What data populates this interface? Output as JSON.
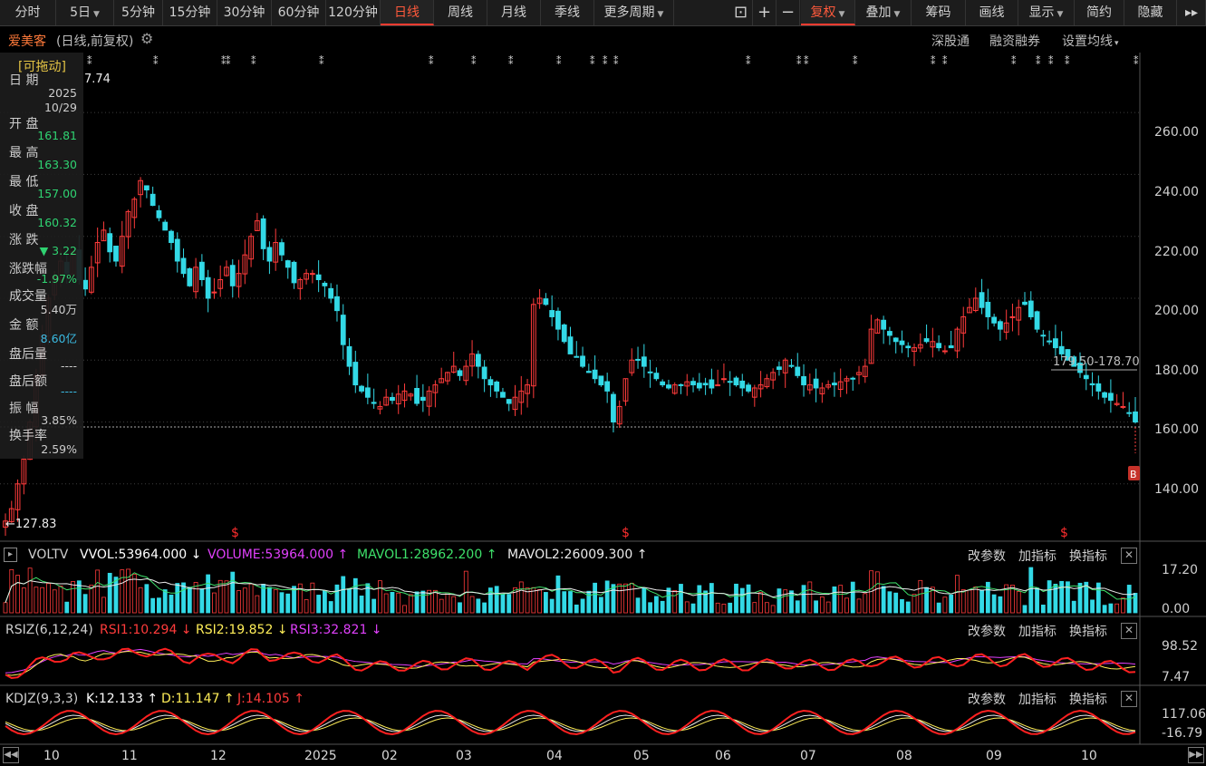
{
  "toolbar": {
    "left": [
      {
        "label": "分时"
      },
      {
        "label": "5日",
        "arrow": true
      },
      {
        "label": "5分钟"
      },
      {
        "label": "15分钟"
      },
      {
        "label": "30分钟"
      },
      {
        "label": "60分钟"
      },
      {
        "label": "120分钟"
      },
      {
        "label": "日线",
        "active": true
      },
      {
        "label": "周线"
      },
      {
        "label": "月线"
      },
      {
        "label": "季线"
      },
      {
        "label": "更多周期",
        "arrow": true
      }
    ],
    "right": [
      {
        "label": "复权",
        "arrow": true,
        "active": true
      },
      {
        "label": "叠加",
        "arrow": true
      },
      {
        "label": "筹码"
      },
      {
        "label": "画线"
      },
      {
        "label": "显示",
        "arrow": true
      },
      {
        "label": "简约"
      },
      {
        "label": "隐藏"
      }
    ]
  },
  "stock": {
    "name": "爱美客",
    "mode": "(日线,前复权)"
  },
  "links": {
    "shengutong": "深股通",
    "rongzi": "融资融券",
    "ma_settings": "设置均线"
  },
  "info": {
    "drag_label": "[可拖动]",
    "rows": [
      {
        "label": "日  期",
        "value": "2025",
        "value2": "10/29",
        "color": "#dddddd"
      },
      {
        "label": "开  盘",
        "value": "161.81",
        "color": "#33e27a"
      },
      {
        "label": "最  高",
        "value": "163.30",
        "color": "#33e27a"
      },
      {
        "label": "最  低",
        "value": "157.00",
        "color": "#33e27a"
      },
      {
        "label": "收  盘",
        "value": "160.32",
        "color": "#33e27a"
      },
      {
        "label": "涨  跌",
        "value": "▼ 3.22",
        "color": "#33e27a"
      },
      {
        "label": "涨跌幅",
        "value": "-1.97%",
        "color": "#33e27a"
      },
      {
        "label": "成交量",
        "value": "5.40万",
        "color": "#dddddd"
      },
      {
        "label": "金  额",
        "value": "8.60亿",
        "color": "#3fc9f4"
      },
      {
        "label": "盘后量",
        "value": "----",
        "color": "#dddddd"
      },
      {
        "label": "盘后额",
        "value": "----",
        "color": "#3fc9f4"
      },
      {
        "label": "振  幅",
        "value": "3.85%",
        "color": "#dddddd"
      },
      {
        "label": "换手率",
        "value": "2.59%",
        "color": "#dddddd"
      }
    ]
  },
  "main_axis": [
    "260.00",
    "240.00",
    "220.00",
    "200.00",
    "180.00",
    "160.00",
    "140.00"
  ],
  "annotations": {
    "high": "247.74",
    "low": "127.83",
    "range": "179.50-178.70",
    "badge": "B",
    "dividend": "$"
  },
  "vol": {
    "title": "VOLTV",
    "v1": "VVOL:53964.000 ↓",
    "v2": "VOLUME:53964.000 ↑",
    "v3": "MAVOL1:28962.200 ↑",
    "v4": "MAVOL2:26009.300 ↑",
    "axis": [
      "17.20",
      "0.00"
    ]
  },
  "rsi": {
    "title": "RSIZ(6,12,24)",
    "v1": "RSI1:10.294 ↓",
    "v2": "RSI2:19.852 ↓",
    "v3": "RSI3:32.821 ↓",
    "axis": [
      "98.52",
      "7.47"
    ]
  },
  "kdj": {
    "title": "KDJZ(9,3,3)",
    "v1": "K:12.133 ↑",
    "v2": "D:11.147 ↑",
    "v3": "J:14.105 ↑",
    "axis": [
      "117.06",
      "-16.79"
    ]
  },
  "ind_buttons": {
    "modify": "改参数",
    "add": "加指标",
    "swap": "换指标"
  },
  "months": [
    "10",
    "11",
    "12",
    "2025",
    "02",
    "03",
    "04",
    "05",
    "06",
    "07",
    "08",
    "09",
    "10"
  ],
  "icons": {
    "lock": "lock-icon",
    "plus": "plus-icon",
    "minus": "minus-icon",
    "close": "close-icon",
    "scroll_left": "scroll-left-icon",
    "scroll_right": "scroll-right-icon",
    "expand": "expand-icon",
    "gear": "gear-icon"
  },
  "colors": {
    "up": "#ff3b3b",
    "down": "#33d9e6",
    "bg": "#000000",
    "grid": "#444444",
    "accent": "#ff3b30"
  },
  "chart_data": {
    "type": "candlestick",
    "series_close": [
      128,
      132,
      140,
      148,
      160,
      175,
      188,
      200,
      207,
      212,
      208,
      215,
      206,
      203,
      210,
      218,
      222,
      215,
      212,
      220,
      228,
      232,
      238,
      235,
      230,
      226,
      222,
      218,
      212,
      208,
      204,
      210,
      206,
      200,
      202,
      206,
      210,
      204,
      208,
      214,
      220,
      225,
      216,
      212,
      218,
      214,
      210,
      205,
      206,
      208,
      208,
      206,
      204,
      200,
      196,
      185,
      178,
      172,
      170,
      168,
      166,
      165,
      168,
      167,
      169,
      170,
      169,
      166,
      167,
      170,
      172,
      174,
      176,
      178,
      175,
      178,
      182,
      178,
      174,
      172,
      170,
      168,
      166,
      168,
      170,
      172,
      198,
      200,
      198,
      194,
      190,
      186,
      182,
      181,
      178,
      176,
      174,
      172,
      170,
      160,
      165,
      174,
      180,
      180,
      178,
      176,
      174,
      172,
      171,
      172,
      172,
      173,
      172,
      171,
      172,
      171,
      172,
      174,
      173,
      172,
      171,
      170,
      171,
      172,
      174,
      176,
      177,
      180,
      178,
      175,
      172,
      172,
      171,
      171,
      172,
      172,
      173,
      174,
      174,
      176,
      178,
      190,
      193,
      190,
      188,
      186,
      185,
      184,
      184,
      185,
      186,
      186,
      184,
      183,
      184,
      190,
      194,
      197,
      200,
      197,
      194,
      192,
      190,
      192,
      194,
      197,
      198,
      194,
      190,
      188,
      186,
      184,
      182,
      180,
      178,
      176,
      174,
      172,
      170,
      168,
      167,
      166,
      165,
      163,
      160
    ],
    "ylim": [
      125,
      270
    ],
    "volume_axis": [
      0,
      17.2
    ],
    "rsi_axis": [
      7.47,
      98.52
    ],
    "kdj_axis": [
      -16.79,
      117.06
    ]
  }
}
